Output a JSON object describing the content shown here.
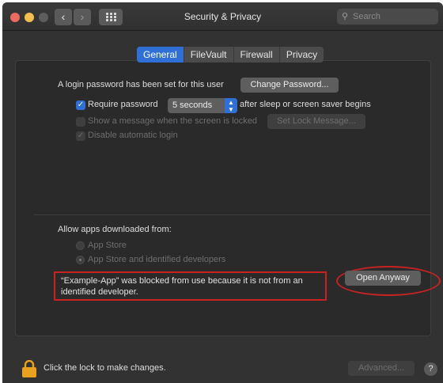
{
  "window": {
    "title": "Security & Privacy"
  },
  "search": {
    "placeholder": "Search"
  },
  "tabs": [
    {
      "label": "General",
      "active": true
    },
    {
      "label": "FileVault",
      "active": false
    },
    {
      "label": "Firewall",
      "active": false
    },
    {
      "label": "Privacy",
      "active": false
    }
  ],
  "general": {
    "login_text": "A login password has been set for this user",
    "change_password_label": "Change Password...",
    "require_password": {
      "label": "Require password",
      "checked": true
    },
    "delay_select": {
      "value": "5 seconds"
    },
    "after_sleep_text": "after sleep or screen saver begins",
    "show_message": {
      "label": "Show a message when the screen is locked",
      "checked": false,
      "enabled": false
    },
    "set_lock_message_label": "Set Lock Message...",
    "disable_autologin": {
      "label": "Disable automatic login",
      "checked": true,
      "enabled": false
    }
  },
  "downloads": {
    "heading": "Allow apps downloaded from:",
    "options": [
      {
        "label": "App Store",
        "selected": false
      },
      {
        "label": "App Store and identified developers",
        "selected": true
      }
    ],
    "blocked_message": "“Example-App” was blocked from use because it is not from an identified developer.",
    "open_anyway_label": "Open Anyway"
  },
  "footer": {
    "lock_text": "Click the lock to make changes.",
    "advanced_label": "Advanced...",
    "help_label": "?"
  },
  "colors": {
    "accent": "#2f6fd6",
    "highlight": "#c82222",
    "lock": "#e8a21f"
  }
}
